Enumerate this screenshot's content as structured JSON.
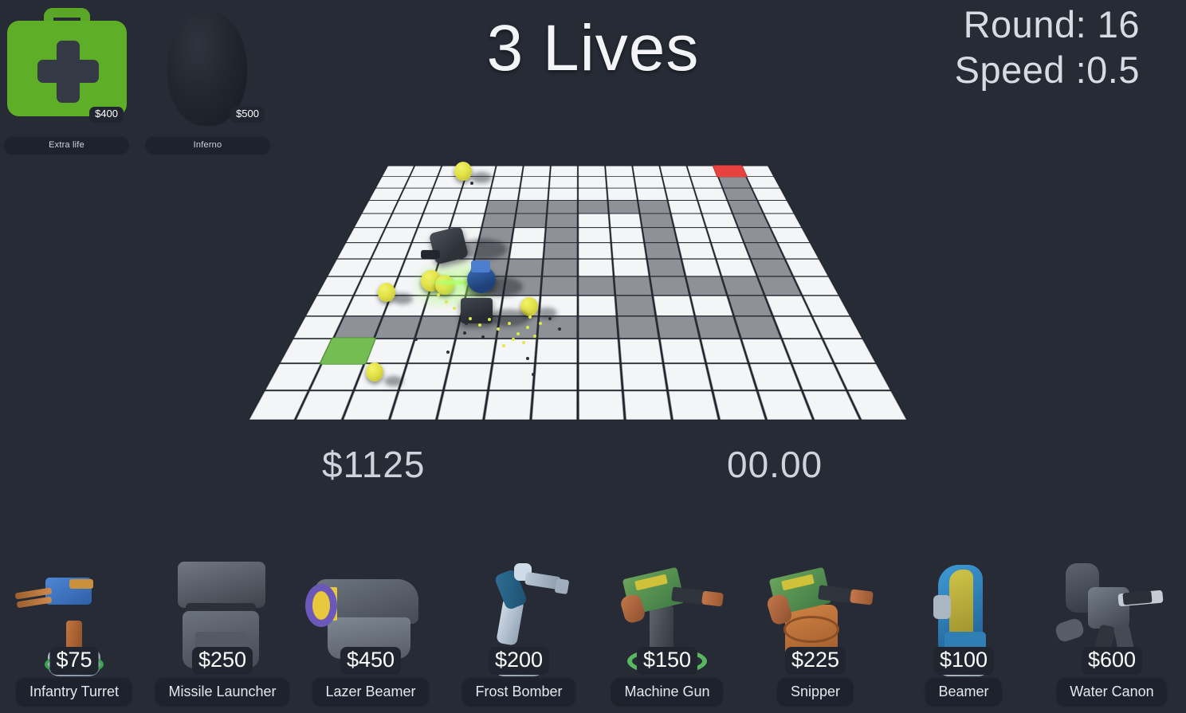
{
  "hud": {
    "lives_text": "3 Lives",
    "round_text": "Round: 16",
    "speed_text": "Speed :0.5",
    "money_text": "$1125",
    "timer_text": "00.00"
  },
  "powerups": [
    {
      "name": "Extra life",
      "price": "$400",
      "icon": "medkit-icon",
      "color": "#5fae28"
    },
    {
      "name": "Inferno",
      "price": "$500",
      "icon": "inferno-icon",
      "color": "#22262f"
    }
  ],
  "shop": [
    {
      "name": "Infantry Turret",
      "price": "$75",
      "icon": "infantry-turret-icon"
    },
    {
      "name": "Missile Launcher",
      "price": "$250",
      "icon": "missile-launcher-icon"
    },
    {
      "name": "Lazer Beamer",
      "price": "$450",
      "icon": "lazer-beamer-icon"
    },
    {
      "name": "Frost Bomber",
      "price": "$200",
      "icon": "frost-bomber-icon"
    },
    {
      "name": "Machine Gun",
      "price": "$150",
      "icon": "machine-gun-icon"
    },
    {
      "name": "Snipper",
      "price": "$225",
      "icon": "snipper-icon"
    },
    {
      "name": "Beamer",
      "price": "$100",
      "icon": "beamer-icon"
    },
    {
      "name": "Water Canon",
      "price": "$600",
      "icon": "water-canon-icon"
    }
  ],
  "board": {
    "grid_size": 14,
    "tile_color": "#f4f5f7",
    "path_color": "#8e9196",
    "spawn_color": "#e8423f",
    "exit_color": "#74bd52",
    "spawn_cell": [
      12,
      0
    ],
    "exit_cell": [
      1,
      11
    ],
    "path_cells": [
      [
        12,
        0
      ],
      [
        12,
        1
      ],
      [
        12,
        2
      ],
      [
        12,
        3
      ],
      [
        12,
        4
      ],
      [
        12,
        5
      ],
      [
        12,
        6
      ],
      [
        12,
        7
      ],
      [
        12,
        8
      ],
      [
        11,
        8
      ],
      [
        10,
        8
      ],
      [
        9,
        8
      ],
      [
        9,
        7
      ],
      [
        9,
        6
      ],
      [
        9,
        5
      ],
      [
        9,
        4
      ],
      [
        9,
        3
      ],
      [
        8,
        3
      ],
      [
        7,
        3
      ],
      [
        6,
        3
      ],
      [
        5,
        3
      ],
      [
        4,
        3
      ],
      [
        4,
        4
      ],
      [
        4,
        5
      ],
      [
        4,
        6
      ],
      [
        4,
        7
      ],
      [
        4,
        8
      ],
      [
        5,
        8
      ],
      [
        6,
        8
      ],
      [
        7,
        8
      ],
      [
        8,
        8
      ],
      [
        8,
        9
      ],
      [
        8,
        10
      ],
      [
        7,
        10
      ],
      [
        6,
        10
      ],
      [
        5,
        10
      ],
      [
        4,
        10
      ],
      [
        3,
        10
      ],
      [
        2,
        10
      ],
      [
        1,
        10
      ],
      [
        1,
        11
      ],
      [
        11,
        9
      ],
      [
        11,
        10
      ],
      [
        10,
        10
      ],
      [
        9,
        10
      ],
      [
        6,
        4
      ],
      [
        6,
        5
      ],
      [
        6,
        6
      ],
      [
        6,
        7
      ],
      [
        5,
        4
      ],
      [
        5,
        7
      ]
    ]
  },
  "colors": {
    "background": "#262b35",
    "pill": "#1d222c",
    "text": "#e3e7ee",
    "accent_green": "#5fae28",
    "laser_green": "#aaff6e"
  }
}
